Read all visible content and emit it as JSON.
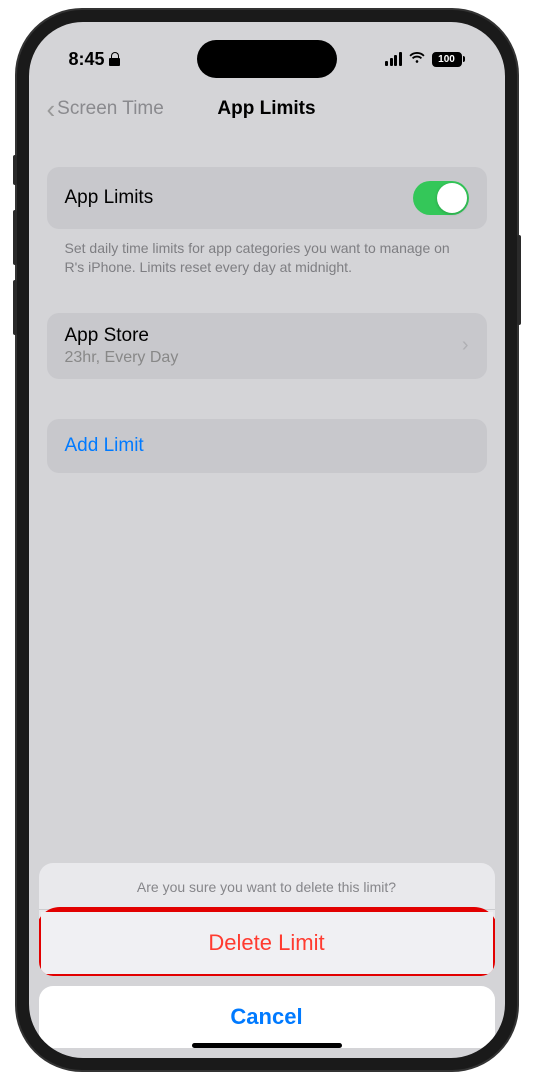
{
  "status": {
    "time": "8:45",
    "battery": "100"
  },
  "nav": {
    "back": "Screen Time",
    "title": "App Limits"
  },
  "toggle_row": {
    "label": "App Limits"
  },
  "description": "Set daily time limits for app categories you want to manage on R's iPhone. Limits reset every day at midnight.",
  "limits": [
    {
      "name": "App Store",
      "detail": "23hr, Every Day"
    }
  ],
  "add_limit": "Add Limit",
  "action_sheet": {
    "message": "Are you sure you want to delete this limit?",
    "destructive": "Delete Limit",
    "cancel": "Cancel"
  }
}
